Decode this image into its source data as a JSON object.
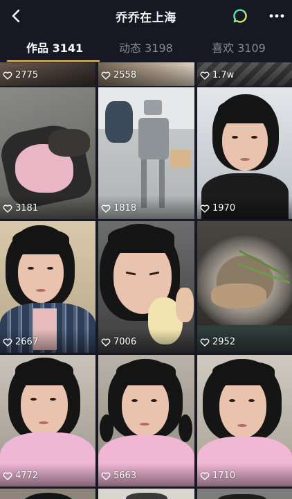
{
  "header": {
    "title": "乔乔在上海"
  },
  "tabs": [
    {
      "label": "作品 3141",
      "active": true
    },
    {
      "label": "动态 3198",
      "active": false
    },
    {
      "label": "喜欢 3109",
      "active": false
    }
  ],
  "colors": {
    "background": "#161823",
    "accent_underline": "#facd00",
    "inactive_tab": "#8a8b91",
    "chat_icon_gradient": [
      "#2ee6c5",
      "#f6e94a"
    ]
  },
  "grid": {
    "rows": [
      {
        "likes": [
          "2775",
          "2558",
          "1.7w"
        ]
      },
      {
        "likes": [
          "3181",
          "1818",
          "1970"
        ]
      },
      {
        "likes": [
          "2667",
          "7006",
          "2952"
        ]
      },
      {
        "likes": [
          "4772",
          "5663",
          "1710"
        ]
      }
    ]
  },
  "icons": {
    "back": "back-chevron-icon",
    "chat": "chat-bubble-icon",
    "more": "more-dots-icon",
    "like": "heart-outline-icon"
  }
}
